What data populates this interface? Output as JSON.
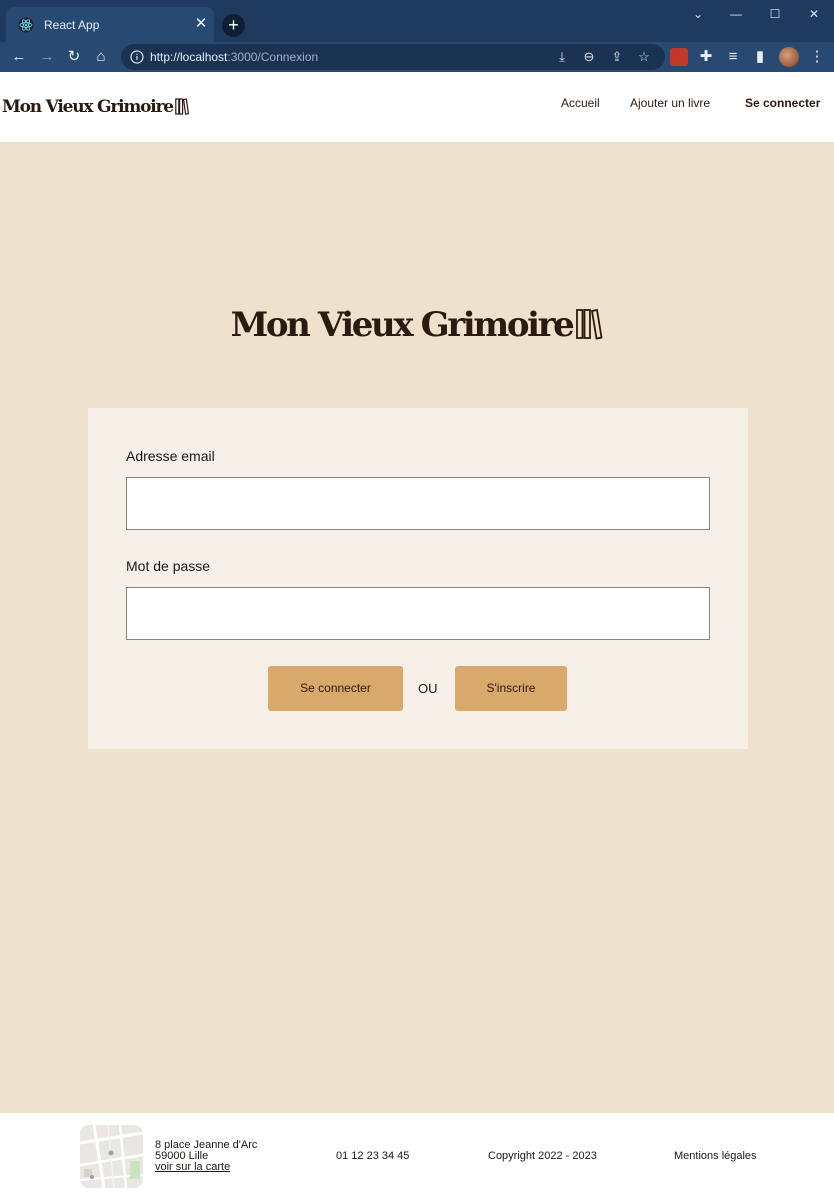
{
  "browser": {
    "tab_title": "React App",
    "new_tab_label": "+",
    "url_host": "http://localhost",
    "url_rest": ":3000/Connexion"
  },
  "header": {
    "brand": "Mon Vieux Grimoire",
    "nav": {
      "home": "Accueil",
      "add_book": "Ajouter un livre",
      "login": "Se connecter"
    }
  },
  "main": {
    "brand": "Mon Vieux Grimoire",
    "form": {
      "email_label": "Adresse email",
      "email_value": "",
      "password_label": "Mot de passe",
      "password_value": "",
      "login_button": "Se connecter",
      "separator": "OU",
      "signup_button": "S'inscrire"
    }
  },
  "footer": {
    "address_line1": "8 place Jeanne d'Arc",
    "address_line2": "59000 Lille",
    "map_link": "voir sur la carte",
    "phone": "01 12 23 34 45",
    "copyright": "Copyright 2022 - 2023",
    "legal": "Mentions légales"
  },
  "colors": {
    "page_bg": "#efe2cc",
    "card_bg": "#f7f0e8",
    "button_bg": "#d9a96c",
    "brand_text": "#2a1a10",
    "chrome_bg": "#1f3a5f"
  }
}
